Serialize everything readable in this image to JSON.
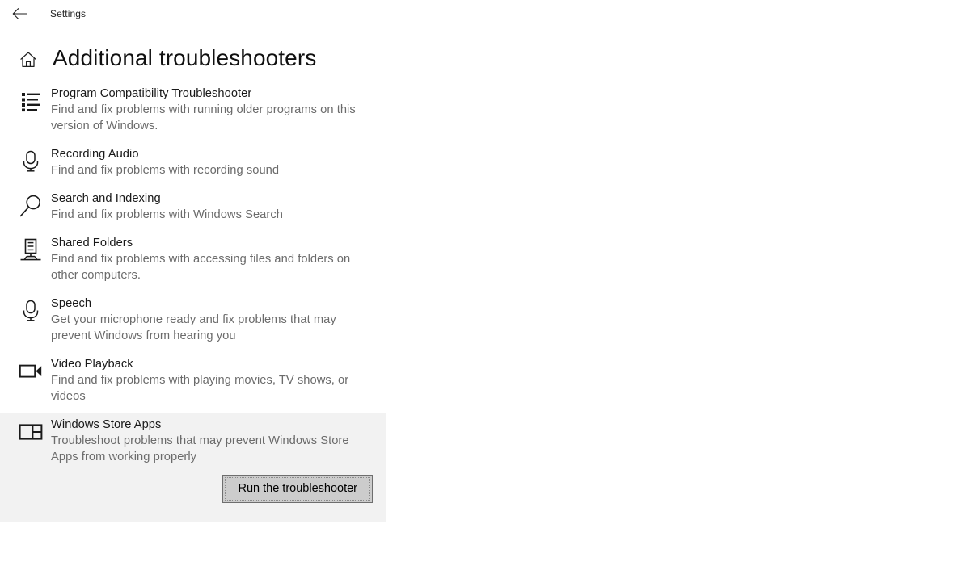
{
  "titlebar": {
    "back_icon": "back-arrow-icon",
    "app_title": "Settings"
  },
  "header": {
    "home_icon": "home-icon",
    "title": "Additional troubleshooters"
  },
  "troubleshooters": [
    {
      "icon": "list-bullets-icon",
      "title": "Program Compatibility Troubleshooter",
      "description": "Find and fix problems with running older programs on this version of Windows.",
      "selected": false
    },
    {
      "icon": "microphone-icon",
      "title": "Recording Audio",
      "description": "Find and fix problems with recording sound",
      "selected": false
    },
    {
      "icon": "magnifier-icon",
      "title": "Search and Indexing",
      "description": "Find and fix problems with Windows Search",
      "selected": false
    },
    {
      "icon": "server-share-icon",
      "title": "Shared Folders",
      "description": "Find and fix problems with accessing files and folders on other computers.",
      "selected": false
    },
    {
      "icon": "microphone-icon",
      "title": "Speech",
      "description": "Get your microphone ready and fix problems that may prevent Windows from hearing you",
      "selected": false
    },
    {
      "icon": "video-camera-icon",
      "title": "Video Playback",
      "description": "Find and fix problems with playing movies, TV shows, or videos",
      "selected": false
    },
    {
      "icon": "store-apps-icon",
      "title": "Windows Store Apps",
      "description": "Troubleshoot problems that may prevent Windows Store Apps from working properly",
      "selected": true
    }
  ],
  "action": {
    "run_button_label": "Run the troubleshooter"
  },
  "colors": {
    "selection_background": "#f2f2f2",
    "button_face": "#cccccc",
    "button_border": "#6e6e6e",
    "title_text": "#191919",
    "description_text": "#6b6b6b"
  }
}
